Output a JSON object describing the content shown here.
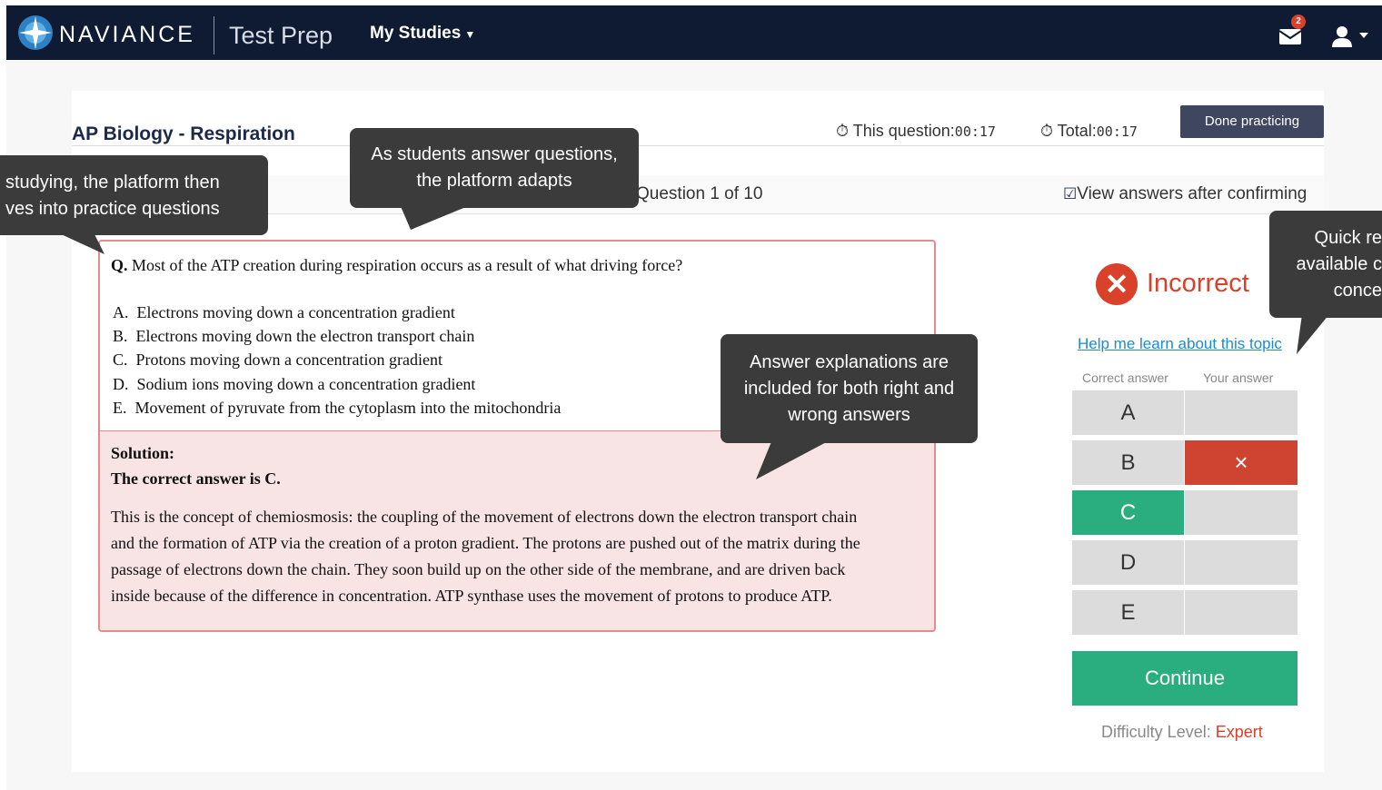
{
  "nav": {
    "brand": "NAVIANCE",
    "product": "Test Prep",
    "menu_label": "My Studies",
    "mail_badge": "2"
  },
  "header": {
    "title": "AP Biology - Respiration",
    "timer_question_label": "This question:",
    "timer_question_value": "00:17",
    "timer_total_label": "Total:",
    "timer_total_value": "00:17",
    "done_button": "Done practicing"
  },
  "subbar": {
    "question_count": "Question 1 of 10",
    "view_answers_label": "View answers after confirming"
  },
  "question": {
    "prefix": "Q.",
    "text": "Most of the ATP creation during respiration occurs as a result of what driving force?",
    "choices": [
      {
        "letter": "A.",
        "text": "Electrons moving down a concentration gradient"
      },
      {
        "letter": "B.",
        "text": "Electrons moving down the electron transport chain"
      },
      {
        "letter": "C.",
        "text": "Protons moving down a concentration gradient"
      },
      {
        "letter": "D.",
        "text": "Sodium ions moving down a concentration gradient"
      },
      {
        "letter": "E.",
        "text": "Movement of pyruvate from the cytoplasm into the mitochondria"
      }
    ]
  },
  "solution": {
    "heading": "Solution:",
    "correct_line": "The correct answer is C.",
    "lines": [
      "This is the concept of chemiosmosis: the coupling of the movement of electrons down the electron transport chain",
      "and the formation of ATP via the creation of a proton gradient. The protons are pushed out of the matrix during the",
      "passage of electrons down the chain. They soon build up on the other side of the membrane, and are driven back",
      "inside because of the difference in concentration. ATP synthase uses the movement of protons to produce ATP."
    ]
  },
  "result": {
    "status": "Incorrect",
    "status_icon": "x-circle-icon",
    "help_link": "Help me learn about this topic",
    "col_correct": "Correct answer",
    "col_yours": "Your answer",
    "options": [
      "A",
      "B",
      "C",
      "D",
      "E"
    ],
    "correct_option": "C",
    "selected_option": "B",
    "wrong_mark": "×",
    "continue_button": "Continue",
    "difficulty_label": "Difficulty Level:",
    "difficulty_value": "Expert"
  },
  "callouts": {
    "left_line1": "studying, the platform then",
    "left_line2": "ves into practice questions",
    "middle_line1": "As students answer questions,",
    "middle_line2": "the platform adapts",
    "explain_line1": "Answer explanations are",
    "explain_line2": "included for both right and",
    "explain_line3": "wrong answers",
    "right_line1": "Quick re",
    "right_line2": "available c",
    "right_line3": "conce"
  },
  "colors": {
    "navbar": "#0e1b33",
    "correct_green": "#2aae7f",
    "incorrect_red": "#d9412b",
    "link_blue": "#1a8ad4",
    "callout_bg": "#3b3b3b"
  }
}
